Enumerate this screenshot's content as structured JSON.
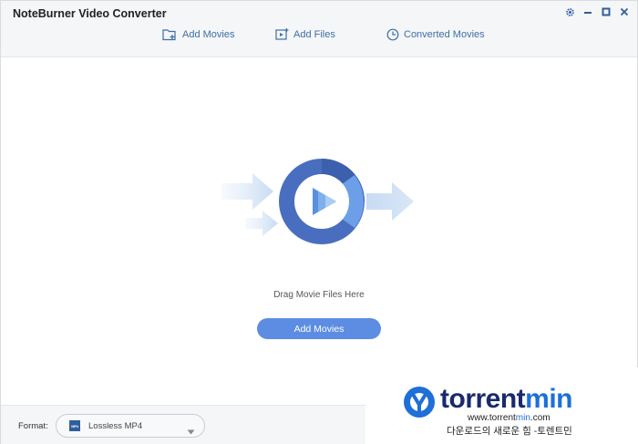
{
  "window": {
    "title": "NoteBurner Video Converter"
  },
  "toolbar": {
    "add_movies": "Add Movies",
    "add_files": "Add Files",
    "converted_movies": "Converted Movies"
  },
  "main": {
    "drag_text": "Drag Movie Files Here",
    "add_movies_button": "Add Movies"
  },
  "footer": {
    "format_label": "Format:",
    "format_value": "Lossless MP4",
    "format_icon_text": "MP4"
  },
  "watermark": {
    "brand_main": "torrent",
    "brand_accent": "min",
    "url_prefix": "www.torrent",
    "url_accent": "min",
    "url_suffix": ".com",
    "tagline": "다운로드의 새로운 힘 -토렌트민"
  },
  "colors": {
    "accent_blue": "#5d8de3",
    "link_blue": "#3f6ea8",
    "header_bg": "#f4f6f8",
    "brand_navy": "#1a2a6c"
  },
  "icons": {
    "settings": "gear-icon",
    "minimize": "minimize-icon",
    "maximize": "maximize-icon",
    "close": "close-icon",
    "add_movies": "add-folder-icon",
    "add_files": "add-video-icon",
    "converted": "clock-icon",
    "dropdown": "chevron-down-icon"
  }
}
